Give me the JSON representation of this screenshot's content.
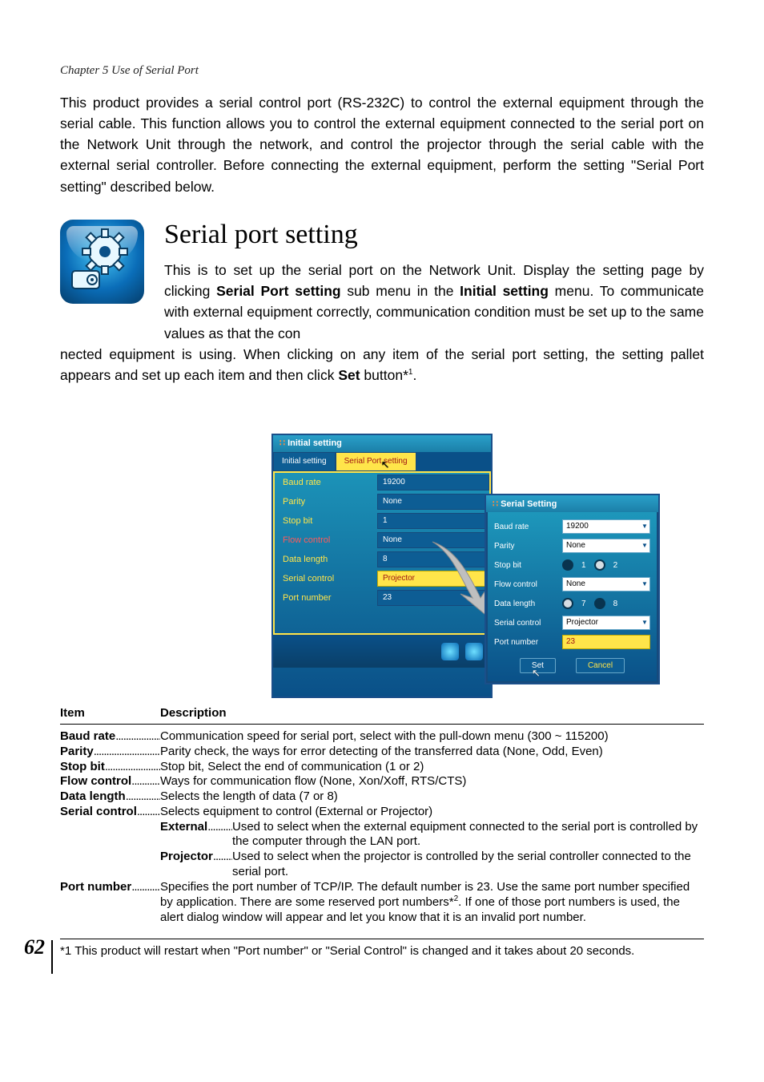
{
  "chapter": "Chapter 5 Use of Serial Port",
  "intro": "This product provides a serial control port (RS-232C) to control the external equipment through the serial cable. This function allows you to control the external equipment connected to the serial port on the Network Unit through the network, and control the projector through the serial cable with the external serial controller. Before connecting the external equipment, perform the setting \"Serial Port setting\" described below.",
  "title": "Serial port setting",
  "body_p1a": "This is to set up the serial port on the Network Unit. Display the setting page by clicking ",
  "body_p1_bold1": "Serial Port setting",
  "body_p1b": " sub menu in the ",
  "body_p1_bold2": "Initial setting",
  "body_p1c": " menu. To communicate with external equipment correctly, communication condition must be set up to the same values as that the con",
  "body_p2a": "nected equipment is using. When clicking on any item of the serial port setting, the setting pallet appears and set up each item and then click ",
  "body_p2_bold": "Set",
  "body_p2b": " button*",
  "body_p2_sup": "1",
  "body_p2_end": ".",
  "ss_left": {
    "title": "Initial setting",
    "tab_left": "Initial setting",
    "tab_right": "Serial Port setting",
    "rows": [
      {
        "label": "Baud rate",
        "value": "19200",
        "lclass": "y"
      },
      {
        "label": "Parity",
        "value": "None",
        "lclass": "y"
      },
      {
        "label": "Stop bit",
        "value": "1",
        "lclass": "y"
      },
      {
        "label": "Flow control",
        "value": "None",
        "lclass": "r"
      },
      {
        "label": "Data length",
        "value": "8",
        "lclass": "y"
      },
      {
        "label": "Serial control",
        "value": "Projector",
        "lclass": "y"
      },
      {
        "label": "Port number",
        "value": "23",
        "lclass": "y"
      }
    ]
  },
  "ss_right": {
    "title": "Serial Setting",
    "rows": {
      "baud": {
        "label": "Baud rate",
        "value": "19200"
      },
      "parity": {
        "label": "Parity",
        "value": "None"
      },
      "stopbit": {
        "label": "Stop bit",
        "opt1": "1",
        "opt2": "2"
      },
      "flow": {
        "label": "Flow control",
        "value": "None"
      },
      "datalen": {
        "label": "Data length",
        "opt1": "7",
        "opt2": "8"
      },
      "serial": {
        "label": "Serial control",
        "value": "Projector"
      },
      "port": {
        "label": "Port number",
        "value": "23"
      }
    },
    "set_btn": "Set",
    "cancel_btn": "Cancel"
  },
  "table": {
    "head_item": "Item",
    "head_desc": "Description",
    "rows": [
      {
        "item": "Baud rate",
        "desc": "Communication speed for serial port, select with the pull-down menu (300 ~ 115200)"
      },
      {
        "item": "Parity",
        "desc": "Parity check, the ways for error detecting of the transferred data (None, Odd, Even)"
      },
      {
        "item": "Stop bit",
        "desc": "Stop bit, Select the end of communication (1 or 2)"
      },
      {
        "item": "Flow control",
        "desc": "Ways for communication flow (None, Xon/Xoff, RTS/CTS)"
      },
      {
        "item": "Data length",
        "desc": "Selects the length of data (7 or 8)"
      },
      {
        "item": "Serial control",
        "desc": "Selects equipment to control (External or Projector)"
      }
    ],
    "sub": [
      {
        "item": "External",
        "desc": "Used to select when the external equipment connected to the serial port is controlled by the computer through the LAN port."
      },
      {
        "item": "Projector",
        "desc": "Used to select when the projector is controlled by the serial controller connected to the serial port."
      }
    ],
    "port": {
      "item": "Port number",
      "desc_a": "Specifies the port number of TCP/IP. The default number is 23. Use the same port number specified by application. There are some reserved port numbers*",
      "sup": "2",
      "desc_b": ". If one of those port numbers is used, the alert dialog window will appear and let you know that it is an invalid port number."
    }
  },
  "footnote": {
    "mark": "*1",
    "text": "This product will restart when \"Port number\" or \"Serial Control\" is changed and it takes about 20 seconds."
  },
  "page_num": "62"
}
